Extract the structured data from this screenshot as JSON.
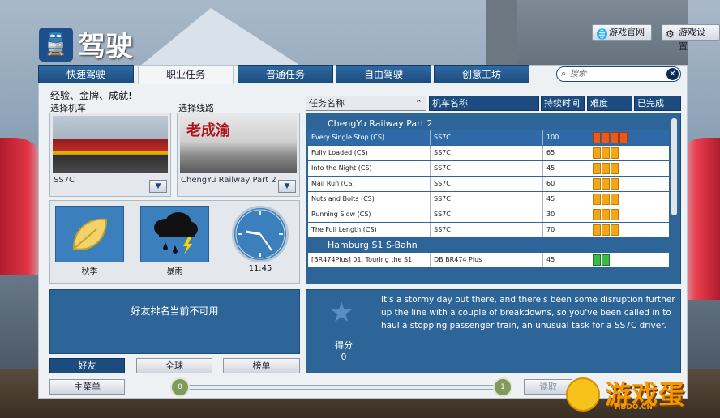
{
  "header": {
    "title": "驾驶",
    "web_btn": "游戏官网",
    "settings_btn": "游戏设置"
  },
  "tabs": [
    {
      "label": "快速驾驶"
    },
    {
      "label": "职业任务"
    },
    {
      "label": "普通任务"
    },
    {
      "label": "自由驾驶"
    },
    {
      "label": "创意工坊"
    }
  ],
  "search": {
    "placeholder": "搜索"
  },
  "left": {
    "subtitle": "经验、金牌、成就!",
    "train_label": "选择机车",
    "route_label": "选择线路",
    "train_name": "SS7C",
    "route_name": "ChengYu Railway Part 2",
    "season": "秋季",
    "weather": "暴雨",
    "time": "11:45",
    "leaderboard_msg": "好友排名当前不可用",
    "lb_tabs": [
      "好友",
      "全球",
      "榜单"
    ]
  },
  "table": {
    "headers": [
      "任务名称",
      "机车名称",
      "持续时间",
      "难度",
      "已完成"
    ],
    "groups": [
      {
        "name": "ChengYu Railway Part 2"
      },
      {
        "name": "Hamburg S1 S-Bahn"
      }
    ],
    "rows": [
      {
        "name": "Every Single Stop (CS)",
        "loco": "SS7C",
        "dur": "100",
        "diff": 4
      },
      {
        "name": "Fully Loaded (CS)",
        "loco": "SS7C",
        "dur": "65",
        "diff": 3
      },
      {
        "name": "Into the Night (CS)",
        "loco": "SS7C",
        "dur": "45",
        "diff": 3
      },
      {
        "name": "Mail Run (CS)",
        "loco": "SS7C",
        "dur": "60",
        "diff": 3
      },
      {
        "name": "Nuts and Bolts (CS)",
        "loco": "SS7C",
        "dur": "45",
        "diff": 3
      },
      {
        "name": "Running Slow (CS)",
        "loco": "SS7C",
        "dur": "30",
        "diff": 3
      },
      {
        "name": "The Full Length (CS)",
        "loco": "SS7C",
        "dur": "70",
        "diff": 3
      },
      {
        "name": "[BR474Plus] 01. Touring the S1",
        "loco": "DB BR474 Plus",
        "dur": "45",
        "diff": 2
      }
    ]
  },
  "details": {
    "score_label": "得分",
    "score_value": "0",
    "description": "It's a stormy day out there, and there's been some disruption further up the line with a couple of breakdowns, so you've been called in to haul a stopping passenger train, an unusual task for a SS7C driver."
  },
  "footer": {
    "main_menu": "主菜单",
    "slider_min": "0",
    "slider_max": "1",
    "load_btn": "读取"
  },
  "watermark": {
    "text": "游戏蛋",
    "url": "HBDO.CN"
  }
}
